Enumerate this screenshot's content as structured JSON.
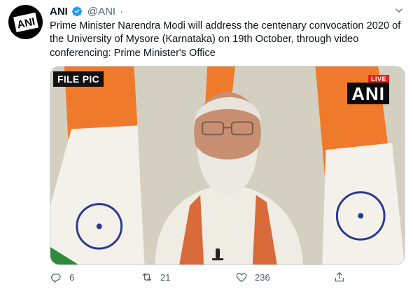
{
  "tweet": {
    "author_name": "ANI",
    "author_handle": "@ANI",
    "separator": "·",
    "avatar_text": "ANI",
    "text": "Prime Minister Narendra Modi will address the centenary convocation 2020 of the University of Mysore (Karnataka) on 19th October, through video conferencing: Prime Minister's Office",
    "media": {
      "file_badge": "FILE PIC",
      "live_badge": "LIVE",
      "channel_logo": "ANI"
    },
    "actions": {
      "replies": "6",
      "retweets": "21",
      "likes": "236"
    }
  },
  "icons": {
    "verified": "verified-badge-icon",
    "caret": "chevron-down-icon",
    "reply": "reply-icon",
    "retweet": "retweet-icon",
    "like": "heart-icon",
    "share": "share-icon"
  },
  "colors": {
    "verified_blue": "#1d9bf0",
    "muted_text": "#536471",
    "primary_text": "#0f1419",
    "saffron": "#f26a21",
    "live_red": "#e2231a"
  }
}
